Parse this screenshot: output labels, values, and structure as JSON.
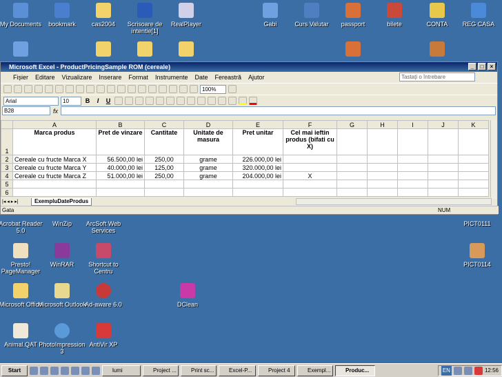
{
  "desktop_icons": [
    {
      "label": "My Documents",
      "icon": "folder-docs-icon",
      "color": "#5b8fd6"
    },
    {
      "label": "bookmark",
      "icon": "ie-shortcut-icon",
      "color": "#4a7fd0"
    },
    {
      "label": "cas2004",
      "icon": "folder-icon",
      "color": "#f2d36b"
    },
    {
      "label": "Scrisoare de intentie[1]",
      "icon": "word-doc-icon",
      "color": "#2a5bb8"
    },
    {
      "label": "RealPlayer",
      "icon": "realplayer-icon",
      "color": "#d0d0e8"
    },
    {
      "label": "Gabi",
      "icon": "computer-icon",
      "color": "#6fa0e0"
    },
    {
      "label": "Curs Valutar",
      "icon": "shortcut-icon",
      "color": "#4f7fc0"
    },
    {
      "label": "passport",
      "icon": "image-icon",
      "color": "#d8703a"
    },
    {
      "label": "bilete",
      "icon": "document-icon",
      "color": "#c94a3a"
    },
    {
      "label": "CONTA",
      "icon": "lightbulb-icon",
      "color": "#e8c84a"
    },
    {
      "label": "REG CASA",
      "icon": "network-icon",
      "color": "#4a8ad8"
    },
    {
      "label": "Acrobat Reader 5.0",
      "icon": "acrobat-icon",
      "color": "#c83030"
    },
    {
      "label": "WinZip",
      "icon": "winzip-icon",
      "color": "#e8d870"
    },
    {
      "label": "ArcSoft Web Services",
      "icon": "arcsoft-icon",
      "color": "#5080c0"
    },
    {
      "label": "PICT0111",
      "icon": "picture-icon",
      "color": "#d89a5a"
    },
    {
      "label": "Presto! PageManager",
      "icon": "presto-icon",
      "color": "#f0e0c0"
    },
    {
      "label": "WinRAR",
      "icon": "winrar-icon",
      "color": "#8a3a9a"
    },
    {
      "label": "Shortcut to Centru",
      "icon": "shortcut-icon",
      "color": "#c84a6a"
    },
    {
      "label": "PICT0114",
      "icon": "picture-icon",
      "color": "#d89a5a"
    },
    {
      "label": "Microsoft Office",
      "icon": "folder-icon",
      "color": "#f2d36b"
    },
    {
      "label": "Microsoft Outlook",
      "icon": "outlook-icon",
      "color": "#e8d890"
    },
    {
      "label": "Ad-aware 6.0",
      "icon": "adaware-icon",
      "color": "#c83a3a"
    },
    {
      "label": "DClean",
      "icon": "dclean-icon",
      "color": "#c83aa8"
    },
    {
      "label": "Animal.QAT",
      "icon": "qat-icon",
      "color": "#f0e8d8"
    },
    {
      "label": "PhotoImpression 3",
      "icon": "photoimpression-icon",
      "color": "#5a9ad8"
    },
    {
      "label": "AntiVir XP",
      "icon": "antivir-icon",
      "color": "#d83a3a"
    }
  ],
  "excel": {
    "title": "Microsoft Excel - ProductPricingSample ROM (cereale)",
    "menu": [
      "Fișier",
      "Editare",
      "Vizualizare",
      "Inserare",
      "Format",
      "Instrumente",
      "Date",
      "Fereastră",
      "Ajutor"
    ],
    "help_placeholder": "Tastați o întrebare",
    "zoom": "100%",
    "font_name": "Arial",
    "font_size": "10",
    "name_box": "B28",
    "fx": "fx",
    "columns": [
      "A",
      "B",
      "C",
      "D",
      "E",
      "F",
      "G",
      "H",
      "I",
      "J",
      "K"
    ],
    "row_numbers": [
      "1",
      "2",
      "3",
      "4",
      "5",
      "6"
    ],
    "headers": [
      "Marca produs",
      "Pret de vinzare",
      "Cantitate",
      "Unitate de masura",
      "Pret unitar",
      "Cel mai ieftin produs (bifati cu X)"
    ],
    "rows": [
      [
        "Cereale cu fructe Marca X",
        "56.500,00 lei",
        "250,00",
        "grame",
        "226.000,00 lei",
        ""
      ],
      [
        "Cereale cu fructe Marca Y",
        "40.000,00 lei",
        "125,00",
        "grame",
        "320.000,00 lei",
        ""
      ],
      [
        "Cereale cu fructe Marca Z",
        "51.000,00 lei",
        "250,00",
        "grame",
        "204.000,00 lei",
        "X"
      ]
    ],
    "sheet_tab": "ExempluDateProdus",
    "status_left": "Gata",
    "status_right": "NUM"
  },
  "taskbar": {
    "start": "Start",
    "tasks": [
      "lumi",
      "Project ...",
      "Print sc...",
      "Excel-P...",
      "Project 4",
      "Exempl...",
      "Produc..."
    ],
    "active_task": "Produc...",
    "lang": "EN",
    "clock": "12:56"
  }
}
